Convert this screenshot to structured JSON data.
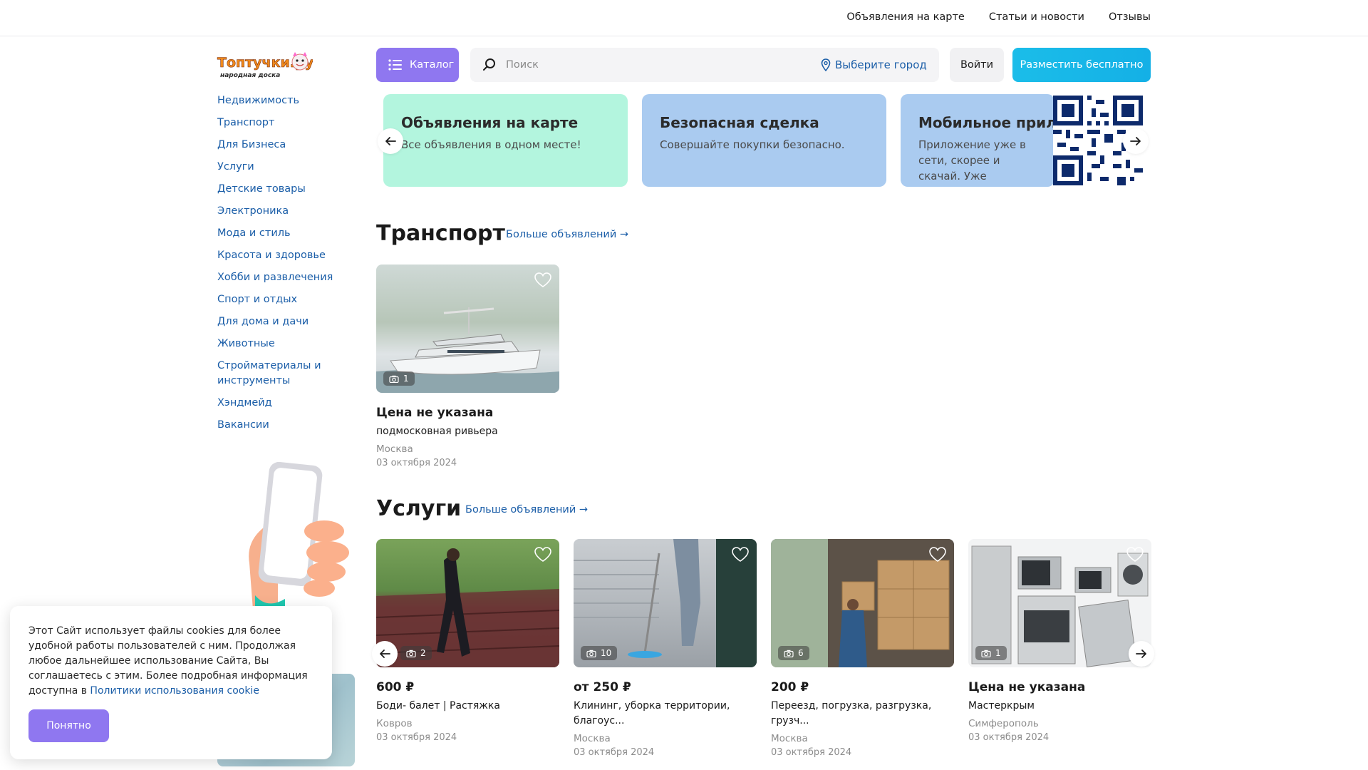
{
  "topnav": [
    "Объявления на карте",
    "Статьи и новости",
    "Отзывы"
  ],
  "logo": {
    "main": "Топтучки.ру",
    "sub": "народная доска"
  },
  "sidebar": {
    "categories": [
      "Недвижимость",
      "Транспорт",
      "Для Бизнеса",
      "Услуги",
      "Детские товары",
      "Электроника",
      "Мода и стиль",
      "Красота и здоровье",
      "Хобби и развлечения",
      "Спорт и отдых",
      "Для дома и дачи",
      "Животные",
      "Стройматериалы и инструменты",
      "Хэндмейд",
      "Вакансии"
    ]
  },
  "header": {
    "catalog_label": "Каталог",
    "search_placeholder": "Поиск",
    "city_label": "Выберите город",
    "login_label": "Войти",
    "post_label": "Разместить бесплатно"
  },
  "banners": [
    {
      "title": "Объявления на карте",
      "subtitle": "Все объявления в одном месте!",
      "color": "#b3f5de"
    },
    {
      "title": "Безопасная сделка",
      "subtitle": "Совершайте покупки безопасно.",
      "color": "#aacbf0"
    },
    {
      "title": "Мобильное приложение",
      "subtitle": "Приложение уже в сети, скорее и скачай. Уже возможно на вашем телефоне",
      "color": "#aacbf0"
    }
  ],
  "sections": {
    "transport": {
      "title": "Транспорт",
      "more": "Больше объявлений",
      "cards": [
        {
          "price": "Цена не указана",
          "title": "подмосковная ривьера",
          "location": "Москва",
          "date": "03 октября 2024",
          "photos": "1"
        }
      ]
    },
    "services": {
      "title": "Услуги",
      "more": "Больше объявлений",
      "cards": [
        {
          "price": "600 ₽",
          "title": "Боди- балет | Растяжка",
          "location": "Ковров",
          "date": "03 октября 2024",
          "photos": "2"
        },
        {
          "price": "от 250 ₽",
          "title": "Клининг, уборка территории, благоус...",
          "location": "Москва",
          "date": "03 октября 2024",
          "photos": "10"
        },
        {
          "price": "200 ₽",
          "title": "Переезд, погрузка, разгрузка, грузч...",
          "location": "Москва",
          "date": "03 октября 2024",
          "photos": "6"
        },
        {
          "price": "Цена не указана",
          "title": "Мастеркрым",
          "location": "Симферополь",
          "date": "03 октября 2024",
          "photos": "1"
        }
      ]
    }
  },
  "cookie": {
    "text": "Этот Сайт использует файлы cookies для более удобной работы пользователей с ним. Продолжая любое дальнейшее использование Сайта, Вы соглашаетесь с этим. Более подробная информация доступна в ",
    "link": "Политики использования cookie",
    "button": "Понятно"
  },
  "colors": {
    "accent": "#8f77f0",
    "link": "#1b5ea8",
    "post_button": "#1bbde9"
  }
}
